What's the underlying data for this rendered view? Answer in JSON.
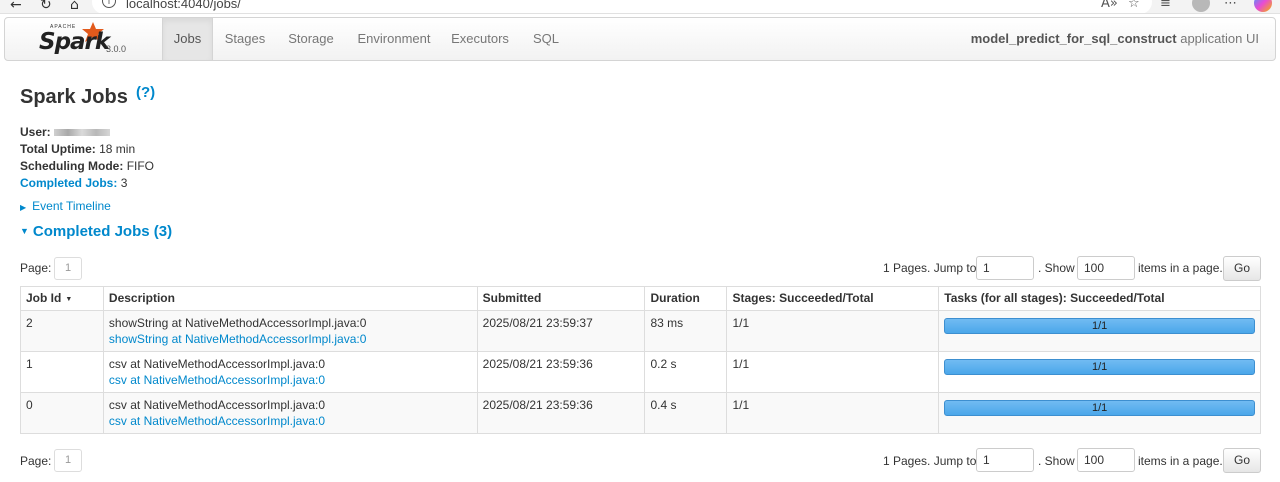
{
  "browser": {
    "url": "localhost:4040/jobs/"
  },
  "navbar": {
    "brand_apache": "APACHE",
    "brand_name": "Spark",
    "version": "3.0.0",
    "tabs": [
      {
        "label": "Jobs",
        "active": true
      },
      {
        "label": "Stages",
        "active": false
      },
      {
        "label": "Storage",
        "active": false
      },
      {
        "label": "Environment",
        "active": false
      },
      {
        "label": "Executors",
        "active": false
      },
      {
        "label": "SQL",
        "active": false
      }
    ],
    "app_name": "model_predict_for_sql_construct",
    "app_suffix": "application UI"
  },
  "page": {
    "title": "Spark Jobs",
    "help": "(?)"
  },
  "summary": {
    "user_label": "User:",
    "uptime_label": "Total Uptime:",
    "uptime_value": "18 min",
    "scheduling_label": "Scheduling Mode:",
    "scheduling_value": "FIFO",
    "completed_label": "Completed Jobs:",
    "completed_value": "3"
  },
  "event_timeline": "Event Timeline",
  "completed_jobs_header": "Completed Jobs (3)",
  "paging": {
    "page_label": "Page:",
    "current_page": "1",
    "pages_text": "1 Pages. Jump to",
    "jump_value": "1",
    "show_text": ". Show",
    "show_value": "100",
    "items_text": "items in a page.",
    "go_label": "Go"
  },
  "table": {
    "headers": [
      "Job Id",
      "Description",
      "Submitted",
      "Duration",
      "Stages: Succeeded/Total",
      "Tasks (for all stages): Succeeded/Total"
    ],
    "rows": [
      {
        "job_id": "2",
        "desc": "showString at NativeMethodAccessorImpl.java:0",
        "desc_link": "showString at NativeMethodAccessorImpl.java:0",
        "submitted": "2025/08/21 23:59:37",
        "duration": "83 ms",
        "stages": "1/1",
        "tasks": "1/1",
        "tasks_fraction": 1.0
      },
      {
        "job_id": "1",
        "desc": "csv at NativeMethodAccessorImpl.java:0",
        "desc_link": "csv at NativeMethodAccessorImpl.java:0",
        "submitted": "2025/08/21 23:59:36",
        "duration": "0.2 s",
        "stages": "1/1",
        "tasks": "1/1",
        "tasks_fraction": 1.0
      },
      {
        "job_id": "0",
        "desc": "csv at NativeMethodAccessorImpl.java:0",
        "desc_link": "csv at NativeMethodAccessorImpl.java:0",
        "submitted": "2025/08/21 23:59:36",
        "duration": "0.4 s",
        "stages": "1/1",
        "tasks": "1/1",
        "tasks_fraction": 1.0
      }
    ]
  },
  "colors": {
    "link": "#0088cc",
    "progress": "#4ba7ea",
    "brand_orange": "#e25a1c"
  }
}
